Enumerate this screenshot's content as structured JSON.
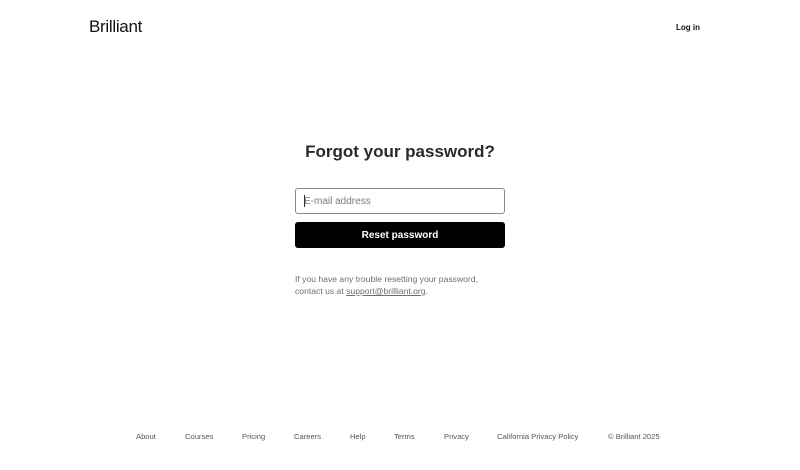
{
  "header": {
    "logo_text": "Brilliant",
    "login_label": "Log in"
  },
  "main": {
    "title": "Forgot your password?",
    "email_placeholder": "E-mail address",
    "email_value": "",
    "reset_label": "Reset password",
    "help_line1": "If you have any trouble resetting your password,",
    "help_prefix": "contact us at ",
    "support_email": "support@brilliant.org",
    "help_suffix": "."
  },
  "footer": {
    "links": [
      "About",
      "Courses",
      "Pricing",
      "Careers",
      "Help",
      "Terms",
      "Privacy",
      "California Privacy Policy"
    ],
    "copyright": "© Brilliant 2025"
  },
  "colors": {
    "primary_button": "#000000",
    "text_muted": "#6e6e6e"
  }
}
